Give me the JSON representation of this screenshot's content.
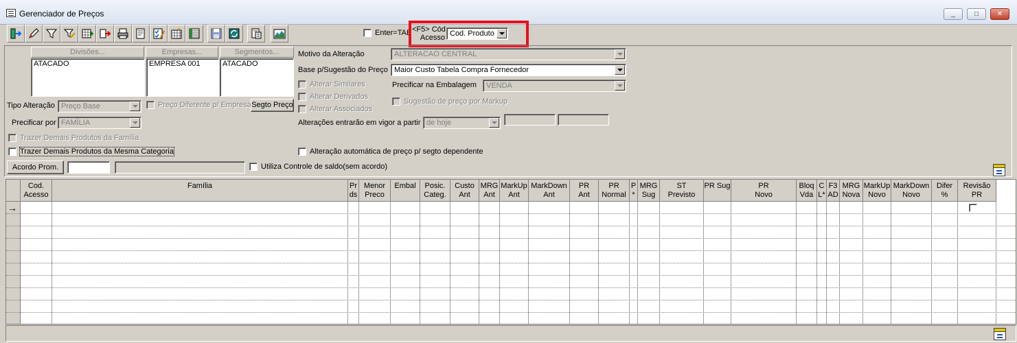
{
  "window": {
    "title": "Gerenciador de Preços",
    "controls": {
      "minimize": "_",
      "maximize": "□",
      "close": "✕"
    }
  },
  "toolbar": {
    "icons": [
      "exit-icon",
      "edit-icon",
      "filter-icon",
      "filter-check-icon",
      "add-grid-icon",
      "arrow-right-icon",
      "print-icon",
      "print-preview-icon",
      "check-list-icon",
      "calendar-grid-icon",
      "table-icon",
      "save-icon",
      "refresh-icon",
      "document-icon",
      "chart-icon"
    ],
    "enter_tab_label": "Enter=TAB",
    "f5_label_line1": "<F5>  Cód",
    "f5_label_line2": "Acesso",
    "cod_select_value": "Cod. Produto"
  },
  "filters": {
    "divisoes_header": "Divisões...",
    "empresas_header": "Empresas...",
    "segmentos_header": "Segmentos...",
    "divisoes_item": "ATACADO",
    "empresas_item": "EMPRESA 001",
    "segmentos_item": "ATACADO",
    "tipo_alteracao_label": "Tipo Alteração",
    "tipo_alteracao_value": "Preço Base",
    "preco_diferente_label": "Preço Diferente p/ Empresa",
    "segto_preco_button": "Segto Preço",
    "precificar_por_label": "Precificar por",
    "precificar_por_value": "FAMÍLIA",
    "trazer_familia_label": "Trazer Demais Produtos da Família",
    "trazer_categoria_label": "Trazer Demais Produtos da Mesma Categoria",
    "acordo_prom_button": "Acordo Prom.",
    "utiliza_saldo_label": "Utiliza Controle de saldo(sem acordo)"
  },
  "right_form": {
    "motivo_label": "Motivo da Alteração",
    "motivo_value": "ALTERACAO CENTRAL",
    "base_label": "Base p/Sugestão do Preço",
    "base_value": "Maior Custo Tabela Compra Fornecedor",
    "alterar_similares": "Alterar Similares",
    "alterar_derivados": "Alterar Derivados",
    "alterar_associados": "Alterar Associados",
    "precificar_embalagem_label": "Precificar na Embalagem",
    "precificar_embalagem_value": "VENDA",
    "sugestao_markup_label": "Sugestão de preço por Markup",
    "alteracoes_vigor_label": "Alterações entrarão em vigor a partir",
    "alteracoes_vigor_value": "de hoje",
    "alteracao_automatica_label": "Alteração automática de preço p/ segto dependente"
  },
  "grid": {
    "columns": [
      {
        "l1": "Cod.",
        "l2": "Acesso"
      },
      {
        "l1": "Família",
        "l2": ""
      },
      {
        "l1": "Pr",
        "l2": "ds"
      },
      {
        "l1": "Menor",
        "l2": "Preco"
      },
      {
        "l1": "Embal",
        "l2": ""
      },
      {
        "l1": "Posic.",
        "l2": "Categ."
      },
      {
        "l1": "Custo",
        "l2": "Ant"
      },
      {
        "l1": "MRG",
        "l2": "Ant"
      },
      {
        "l1": "MarkUp",
        "l2": "Ant"
      },
      {
        "l1": "MarkDown",
        "l2": "Ant"
      },
      {
        "l1": "PR",
        "l2": "Ant"
      },
      {
        "l1": "PR",
        "l2": "Normal"
      },
      {
        "l1": "P",
        "l2": "*"
      },
      {
        "l1": "MRG",
        "l2": "Sug"
      },
      {
        "l1": "ST",
        "l2": "Previsto"
      },
      {
        "l1": "PR Sug",
        "l2": ""
      },
      {
        "l1": "PR",
        "l2": "Novo"
      },
      {
        "l1": "Bloq",
        "l2": "Vda"
      },
      {
        "l1": "C",
        "l2": "L*"
      },
      {
        "l1": "F3",
        "l2": "AD"
      },
      {
        "l1": "MRG",
        "l2": "Nova"
      },
      {
        "l1": "MarkUp",
        "l2": "Novo"
      },
      {
        "l1": "MarkDown",
        "l2": "Novo"
      },
      {
        "l1": "Difer",
        "l2": "%"
      },
      {
        "l1": "Revisão",
        "l2": "PR"
      }
    ],
    "row_indicator": "→"
  }
}
